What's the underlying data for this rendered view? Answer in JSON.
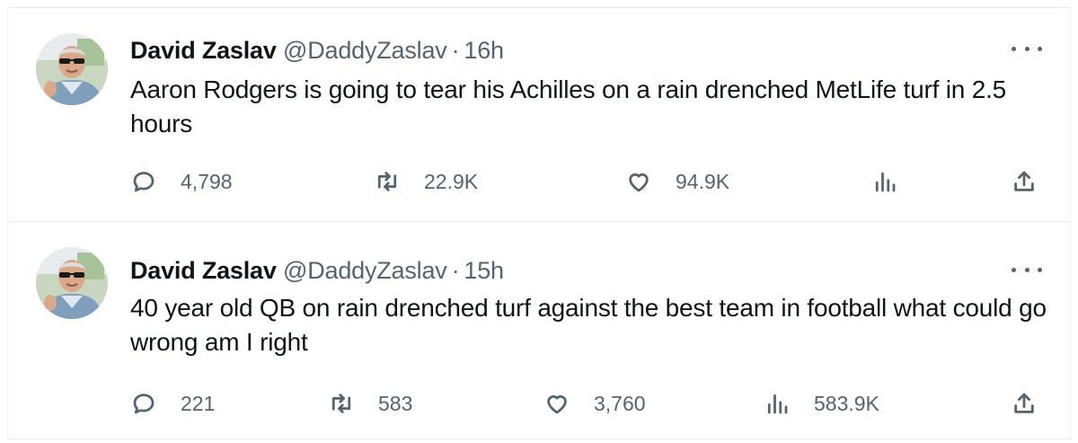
{
  "tweets": [
    {
      "author_name": "David Zaslav",
      "author_handle": "@DaddyZaslav",
      "separator": "·",
      "time": "16h",
      "text": "Aaron Rodgers is going to tear his Achilles on a rain drenched MetLife turf in 2.5 hours",
      "replies": "4,798",
      "reposts": "22.9K",
      "likes": "94.9K",
      "views": ""
    },
    {
      "author_name": "David Zaslav",
      "author_handle": "@DaddyZaslav",
      "separator": "·",
      "time": "15h",
      "text": "40 year old QB on rain drenched turf against the best team in football what could go wrong am I right",
      "replies": "221",
      "reposts": "583",
      "likes": "3,760",
      "views": "583.9K"
    }
  ],
  "icons": {
    "reply": "reply-icon",
    "repost": "repost-icon",
    "like": "heart-icon",
    "views": "views-icon",
    "share": "share-icon",
    "more": "more-icon"
  },
  "colors": {
    "text": "#0f1419",
    "secondary": "#536471",
    "divider": "#e7e9ea"
  }
}
